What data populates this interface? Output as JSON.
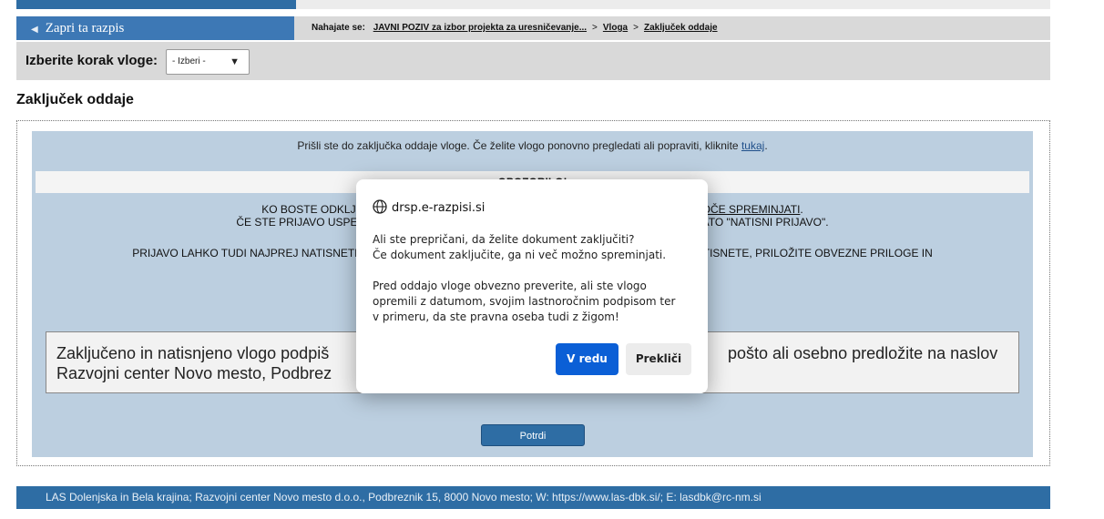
{
  "nav": {
    "close_label": "Zapri ta razpis",
    "breadcrumb_prefix": "Nahajate se:",
    "crumbs": [
      "JAVNI POZIV za izbor projekta za uresničevanje...",
      "Vloga",
      "Zaključek oddaje"
    ],
    "separator": ">"
  },
  "step": {
    "label": "Izberite korak vloge:",
    "selected": "- Izberi -"
  },
  "page_title": "Zaključek oddaje",
  "intro": {
    "text": "Prišli ste do zaključka oddaje vloge. Če želite vlogo ponovno pregledati ali popraviti, kliknite",
    "link": "tukaj",
    "end": "."
  },
  "warning": {
    "heading": "OPOZORILO!",
    "line1_left": "KO BOSTE ODKLJUKALI VNOSN",
    "line1_right": "O VEČ MOGOČE SPREMINJATI",
    "line2_left": "ČE STE PRIJAVO USPEŠNO ZAKLJU",
    "line2_right": "RIJAVO\" IN NATO \"NATISNI PRIJAVO\".",
    "line3_left": "PRIJAVO LAHKO TUDI NAJPREJ NATISNETE, VNESETE",
    "line3_right": "ONČNO NATISNETE, PRILOŽITE OBVEZNE PRILOGE IN"
  },
  "notice": {
    "line1_left": "Zaključeno in natisnjeno vlogo podpiš",
    "line1_right": "pošto ali osebno predložite na naslov",
    "line2_left": "Razvojni center Novo mesto, Podbrez"
  },
  "confirm_button": "Potrdi",
  "footer": "LAS Dolenjska in Bela krajina; Razvojni center Novo mesto d.o.o., Podbreznik 15, 8000 Novo mesto; W: https://www.las-dbk.si/; E: lasdbk@rc-nm.si",
  "dialog": {
    "origin": "drsp.e-razpisi.si",
    "para1_line1": "Ali ste prepričani, da želite dokument zaključiti?",
    "para1_line2": "Če dokument zaključite, ga ni več možno spreminjati.",
    "para2_line1": "Pred oddajo vloge obvezno preverite, ali ste vlogo",
    "para2_line2": "opremili z datumom, svojim lastnoročnim podpisom ter",
    "para2_line3": "v primeru, da ste pravna oseba tudi z žigom!",
    "ok_label": "V redu",
    "cancel_label": "Prekliči"
  },
  "colors": {
    "accent": "#2e6da4",
    "panel": "#bccfe0",
    "dialog_primary": "#0b5fd6"
  }
}
